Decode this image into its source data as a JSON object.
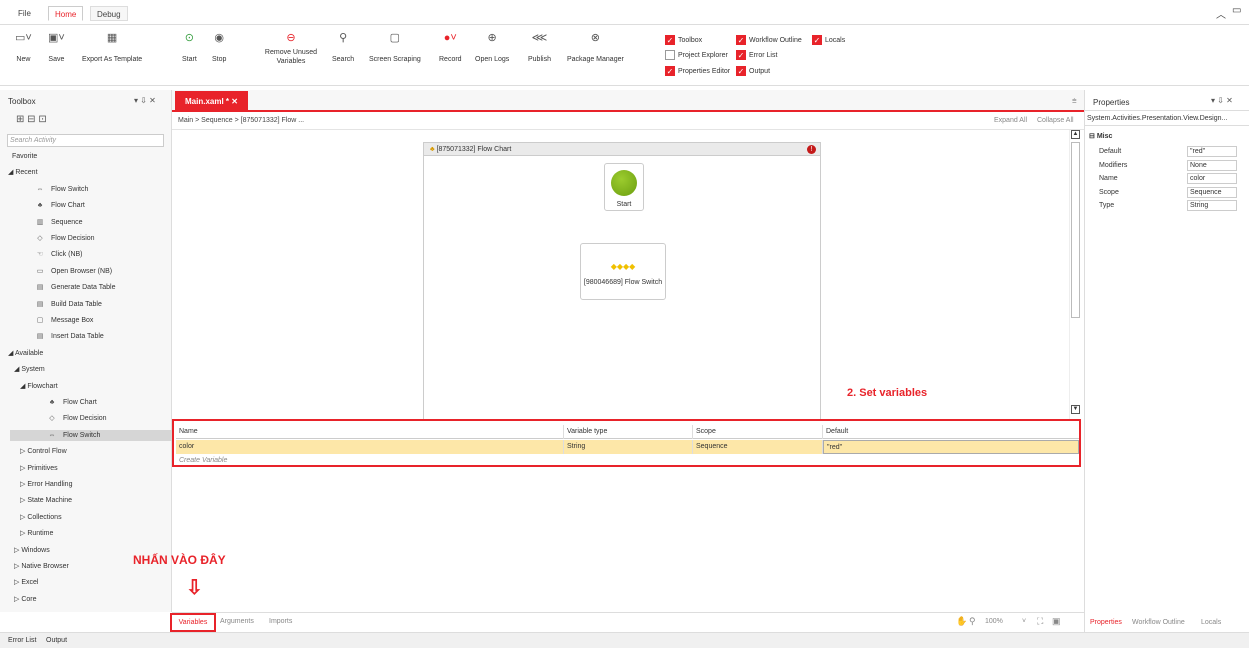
{
  "menu": {
    "file": "File",
    "home": "Home",
    "debug": "Debug"
  },
  "ribbon": {
    "new": "New",
    "save": "Save",
    "export_template": "Export As Template",
    "start": "Start",
    "stop": "Stop",
    "remove_unused": "Remove Unused\nVariables",
    "search": "Search",
    "screen_scraping": "Screen Scraping",
    "record": "Record",
    "open_logs": "Open Logs",
    "publish": "Publish",
    "package_manager": "Package Manager",
    "toolbox": "Toolbox",
    "workflow_outline": "Workflow Outline",
    "locals": "Locals",
    "project_explorer": "Project Explorer",
    "error_list": "Error List",
    "properties_editor": "Properties Editor",
    "output": "Output"
  },
  "toolbox": {
    "title": "Toolbox",
    "search_placeholder": "Search Activity",
    "items": [
      "Favorite",
      "Recent",
      "Flow Switch",
      "Flow Chart",
      "Sequence",
      "Flow Decision",
      "Click (NB)",
      "Open Browser (NB)",
      "Generate Data Table",
      "Build Data Table",
      "Message Box",
      "Insert Data Table",
      "Available",
      "System",
      "Flowchart",
      "Flow Chart",
      "Flow Decision",
      "Flow Switch",
      "Control Flow",
      "Primitives",
      "Error Handling",
      "State Machine",
      "Collections",
      "Runtime",
      "Windows",
      "Native Browser",
      "Excel",
      "Core"
    ]
  },
  "designer": {
    "tab": "Main.xaml *",
    "breadcrumb": "Main  >  Sequence  >  [875071332] Flow ...",
    "expand_all": "Expand All",
    "collapse_all": "Collapse All",
    "flowchart_title": "[875071332] Flow Chart",
    "start_label": "Start",
    "switch_label": "[980046689] Flow Switch"
  },
  "variables": {
    "headers": [
      "Name",
      "Variable type",
      "Scope",
      "Default"
    ],
    "row": {
      "name": "color",
      "type": "String",
      "scope": "Sequence",
      "default": "\"red\""
    },
    "create": "Create Variable"
  },
  "annotations": {
    "set_vars": "2. Set variables",
    "click_here": "NHẤN VÀO ĐÂY"
  },
  "bottom_tabs": {
    "variables": "Variables",
    "arguments": "Arguments",
    "imports": "Imports",
    "zoom": "100%"
  },
  "properties": {
    "title": "Properties",
    "type_path": "System.Activities.Presentation.View.Design...",
    "section": "Misc",
    "rows": [
      {
        "name": "Default",
        "value": "\"red\""
      },
      {
        "name": "Modifiers",
        "value": "None"
      },
      {
        "name": "Name",
        "value": "color"
      },
      {
        "name": "Scope",
        "value": "Sequence"
      },
      {
        "name": "Type",
        "value": "String"
      }
    ],
    "tabs": [
      "Properties",
      "Workflow Outline",
      "Locals"
    ]
  },
  "status": {
    "error_list": "Error List",
    "output": "Output"
  }
}
